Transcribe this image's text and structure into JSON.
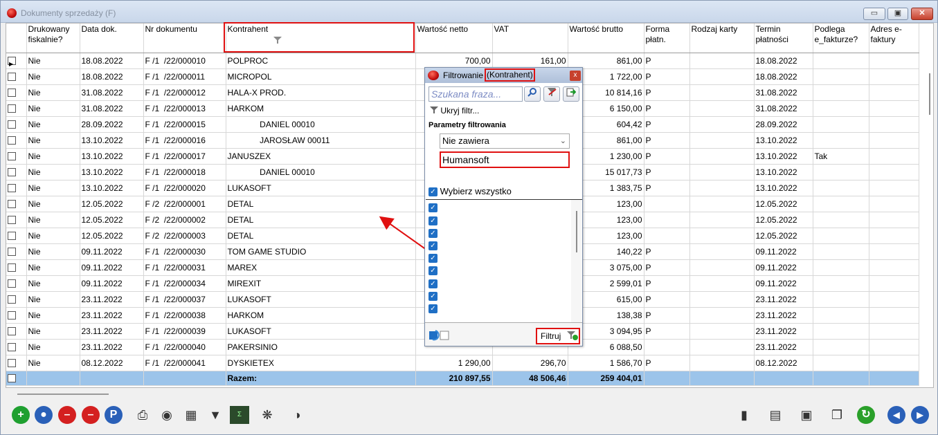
{
  "window": {
    "title": "Dokumenty sprzedaży (F)",
    "min_glyph": "▭",
    "max_glyph": "▣",
    "close_glyph": "✕"
  },
  "columns": [
    "",
    "Drukowany fiskalnie?",
    "Data dok.",
    "Nr dokumentu",
    "Kontrahent",
    "Wartość netto",
    "VAT",
    "Wartość brutto",
    "Forma płatn.",
    "Rodzaj karty",
    "Termin płatności",
    "Podlega e_fakturze?",
    "Adres e-faktury"
  ],
  "rows": [
    [
      "Nie",
      "18.08.2022",
      "F /1  /22/000010",
      "POLPROC",
      "700,00",
      "161,00",
      "861,00",
      "P",
      "",
      "18.08.2022",
      "",
      ""
    ],
    [
      "Nie",
      "18.08.2022",
      "F /1  /22/000011",
      "MICROPOL",
      "",
      "",
      "1 722,00",
      "P",
      "",
      "18.08.2022",
      "",
      ""
    ],
    [
      "Nie",
      "31.08.2022",
      "F /1  /22/000012",
      "HALA-X PROD.",
      "",
      "",
      "10 814,16",
      "P",
      "",
      "31.08.2022",
      "",
      ""
    ],
    [
      "Nie",
      "31.08.2022",
      "F /1  /22/000013",
      "HARKOM",
      "",
      "",
      "6 150,00",
      "P",
      "",
      "31.08.2022",
      "",
      ""
    ],
    [
      "Nie",
      "28.09.2022",
      "F /1  /22/000015",
      "              DANIEL 00010",
      "",
      "",
      "604,42",
      "P",
      "",
      "28.09.2022",
      "",
      ""
    ],
    [
      "Nie",
      "13.10.2022",
      "F /1  /22/000016",
      "              JAROSŁAW 00011",
      "",
      "",
      "861,00",
      "P",
      "",
      "13.10.2022",
      "",
      ""
    ],
    [
      "Nie",
      "13.10.2022",
      "F /1  /22/000017",
      "JANUSZEX",
      "",
      "",
      "1 230,00",
      "P",
      "",
      "13.10.2022",
      "Tak",
      ""
    ],
    [
      "Nie",
      "13.10.2022",
      "F /1  /22/000018",
      "              DANIEL 00010",
      "",
      "",
      "15 017,73",
      "P",
      "",
      "13.10.2022",
      "",
      ""
    ],
    [
      "Nie",
      "13.10.2022",
      "F /1  /22/000020",
      "LUKASOFT",
      "",
      "",
      "1 383,75",
      "P",
      "",
      "13.10.2022",
      "",
      ""
    ],
    [
      "Nie",
      "12.05.2022",
      "F /2  /22/000001",
      "DETAL",
      "",
      "",
      "123,00",
      "",
      "",
      "12.05.2022",
      "",
      ""
    ],
    [
      "Nie",
      "12.05.2022",
      "F /2  /22/000002",
      "DETAL",
      "",
      "",
      "123,00",
      "",
      "",
      "12.05.2022",
      "",
      ""
    ],
    [
      "Nie",
      "12.05.2022",
      "F /2  /22/000003",
      "DETAL",
      "",
      "",
      "123,00",
      "",
      "",
      "12.05.2022",
      "",
      ""
    ],
    [
      "Nie",
      "09.11.2022",
      "F /1  /22/000030",
      "TOM GAME STUDIO",
      "",
      "",
      "140,22",
      "P",
      "",
      "09.11.2022",
      "",
      ""
    ],
    [
      "Nie",
      "09.11.2022",
      "F /1  /22/000031",
      "MAREX",
      "",
      "",
      "3 075,00",
      "P",
      "",
      "09.11.2022",
      "",
      ""
    ],
    [
      "Nie",
      "09.11.2022",
      "F /1  /22/000034",
      "MIREXIT",
      "",
      "",
      "2 599,01",
      "P",
      "",
      "09.11.2022",
      "",
      ""
    ],
    [
      "Nie",
      "23.11.2022",
      "F /1  /22/000037",
      "LUKASOFT",
      "",
      "",
      "615,00",
      "P",
      "",
      "23.11.2022",
      "",
      ""
    ],
    [
      "Nie",
      "23.11.2022",
      "F /1  /22/000038",
      "HARKOM",
      "",
      "",
      "138,38",
      "P",
      "",
      "23.11.2022",
      "",
      ""
    ],
    [
      "Nie",
      "23.11.2022",
      "F /1  /22/000039",
      "LUKASOFT",
      "",
      "",
      "3 094,95",
      "P",
      "",
      "23.11.2022",
      "",
      ""
    ],
    [
      "Nie",
      "23.11.2022",
      "F /1  /22/000040",
      "PAKERSINIO",
      "",
      "",
      "6 088,50",
      "",
      "",
      "23.11.2022",
      "",
      ""
    ],
    [
      "Nie",
      "08.12.2022",
      "F /1  /22/000041",
      "DYSKIETEX",
      "1 290,00",
      "296,70",
      "1 586,70",
      "P",
      "",
      "08.12.2022",
      "",
      ""
    ]
  ],
  "summary": {
    "label": "Razem:",
    "netto": "210 897,55",
    "vat": "48 506,46",
    "brutto": "259 404,01"
  },
  "filter_dialog": {
    "title": "Filtrowanie",
    "title_field": "(Kontrahent)",
    "close_glyph": "x",
    "search_placeholder": "Szukana fraza...",
    "hide_filter": "Ukryj filtr...",
    "params_label": "Parametry filtrowania",
    "condition": "Nie zawiera",
    "value": "Humansoft",
    "select_all": "Wybierz wszystko",
    "list_count": 9,
    "filter_button": "Filtruj"
  },
  "icons": {
    "search": "search-icon",
    "clear_filter": "clear-filter-icon",
    "export": "export-icon",
    "funnel": "funnel-icon"
  },
  "colors": {
    "highlight": "#e01010",
    "summary_row": "#9cc4ea",
    "checkbox_blue": "#1f6fc5"
  }
}
